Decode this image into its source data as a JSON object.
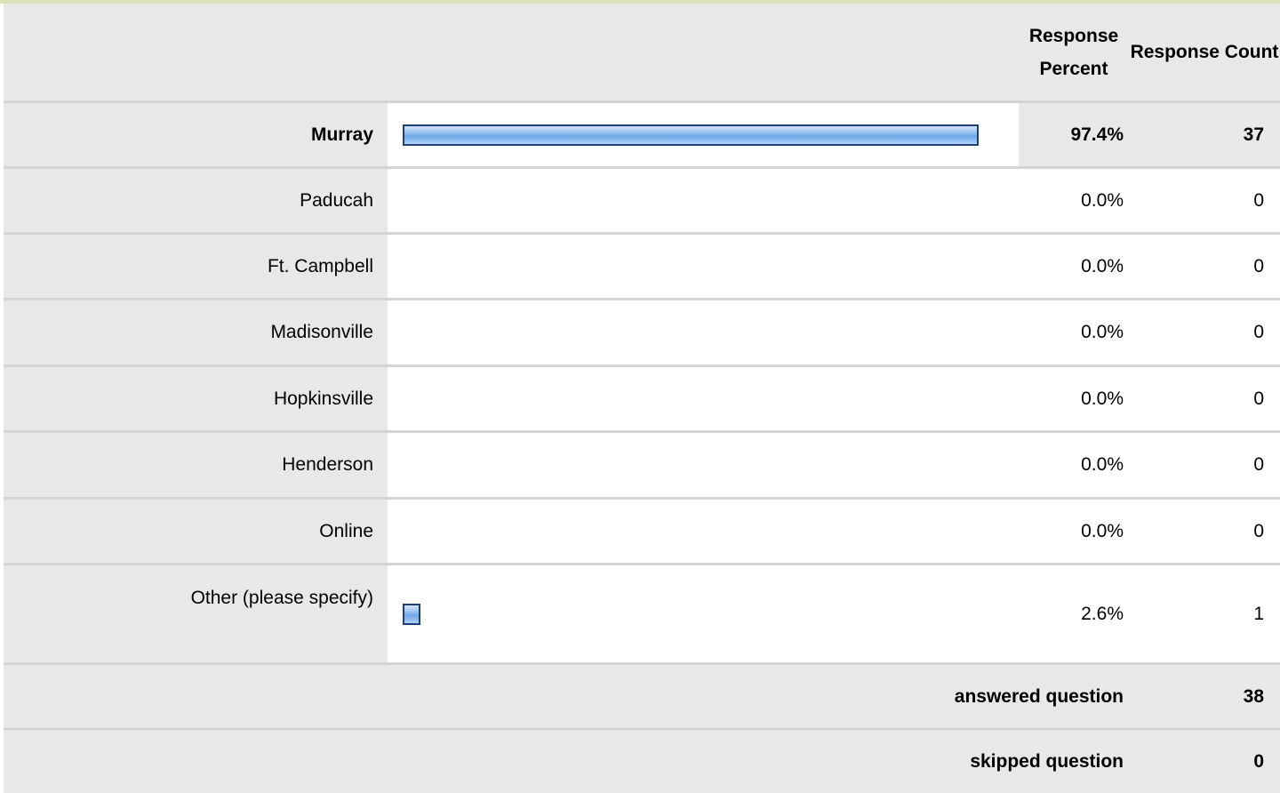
{
  "header": {
    "response_percent": "Response Percent",
    "response_count": "Response Count"
  },
  "rows": [
    {
      "label": "Murray",
      "percent": "97.4%",
      "count": "37",
      "fraction": 0.974,
      "bold": true
    },
    {
      "label": "Paducah",
      "percent": "0.0%",
      "count": "0",
      "fraction": 0.0
    },
    {
      "label": "Ft. Campbell",
      "percent": "0.0%",
      "count": "0",
      "fraction": 0.0
    },
    {
      "label": "Madisonville",
      "percent": "0.0%",
      "count": "0",
      "fraction": 0.0
    },
    {
      "label": "Hopkinsville",
      "percent": "0.0%",
      "count": "0",
      "fraction": 0.0
    },
    {
      "label": "Henderson",
      "percent": "0.0%",
      "count": "0",
      "fraction": 0.0
    },
    {
      "label": "Online",
      "percent": "0.0%",
      "count": "0",
      "fraction": 0.0
    },
    {
      "label": "Other (please specify)",
      "percent": "2.6%",
      "count": "1",
      "fraction": 0.026
    }
  ],
  "summary": {
    "answered_label": "answered question",
    "answered_count": "38",
    "skipped_label": "skipped question",
    "skipped_count": "0"
  },
  "colors": {
    "bar_border": "#1e3f74",
    "bar_fill": "#8dbcf0",
    "header_bg": "#e8e8e8",
    "top_accent": "#d8e3b6"
  }
}
